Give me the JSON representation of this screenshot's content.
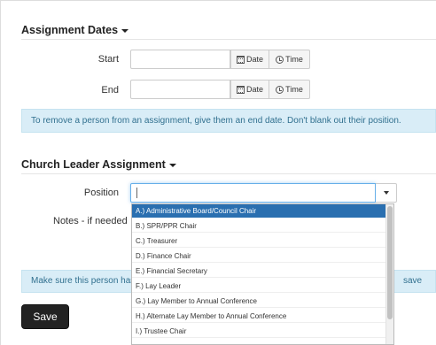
{
  "assignment_dates": {
    "heading": "Assignment Dates",
    "start_label": "Start",
    "end_label": "End",
    "date_button": "Date",
    "time_button": "Time",
    "start_value": "",
    "end_value": ""
  },
  "info_message": "To remove a person from an assignment, give them an end date. Don't blank out their position.",
  "church_leader": {
    "heading": "Church Leader Assignment",
    "position_label": "Position",
    "position_value": "",
    "notes_label": "Notes - if needed",
    "options": [
      "A.) Administrative Board/Council Chair",
      "B.) SPR/PPR Chair",
      "C.) Treasurer",
      "D.) Finance Chair",
      "E.) Financial Secretary",
      "F.) Lay Leader",
      "G.) Lay Member to Annual Conference",
      "H.) Alternate Lay Member to Annual Conference",
      "I.) Trustee Chair"
    ],
    "selected_option": "A.) Administrative Board/Council Chair"
  },
  "warning_message": {
    "start": "Make sure this person has",
    "end": "save"
  },
  "save_button": "Save",
  "icons": {
    "caret": "chevron-down-icon",
    "date": "calendar-icon",
    "time": "clock-icon"
  }
}
